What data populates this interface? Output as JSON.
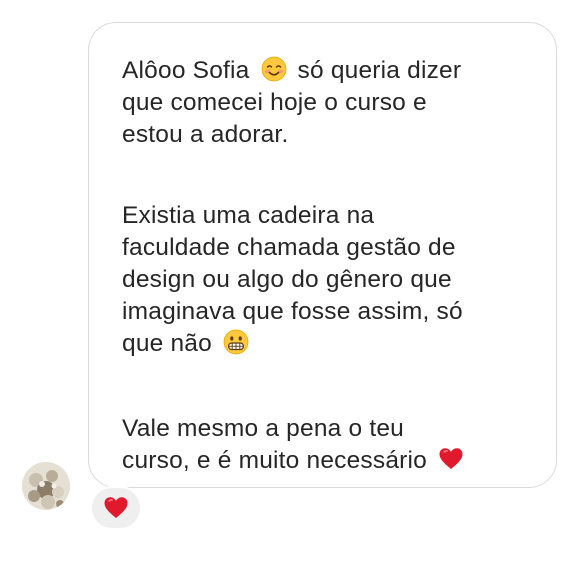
{
  "message": {
    "paragraph1": {
      "line1_before": "Alôoo Sofia",
      "line1_emoji": "smiling-face-icon",
      "line1_after": "só queria dizer",
      "line2": "que comecei hoje o curso e",
      "line3": "estou a adorar."
    },
    "paragraph2": {
      "line1": "Existia uma cadeira na",
      "line2": "faculdade chamada gestão de",
      "line3": "design ou algo do gênero que",
      "line4": "imaginava que fosse assim, só",
      "line5_before": "que não",
      "line5_emoji": "grimacing-face-icon"
    },
    "paragraph3": {
      "line1": "Vale mesmo a pena o teu",
      "line2_before": "curso, e é muito necessário",
      "line2_emoji": "red-heart-icon"
    }
  },
  "reaction": {
    "emoji": "red-heart-icon"
  },
  "colors": {
    "text": "#262626",
    "bubble_border": "#dbdbdb",
    "reaction_bg": "#efefef",
    "heart": "#e0192d"
  }
}
